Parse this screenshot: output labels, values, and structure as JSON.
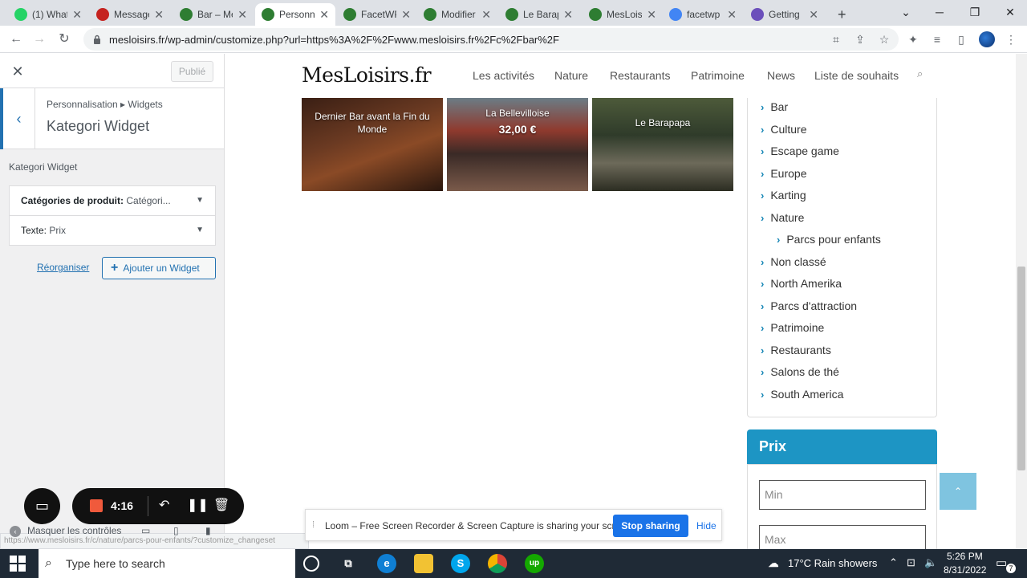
{
  "browser": {
    "tabs": [
      {
        "label": "(1) What",
        "icon": "whatsapp-icon",
        "color": "#25d366"
      },
      {
        "label": "Message",
        "icon": "gmail-icon",
        "color": "#c5221f"
      },
      {
        "label": "Bar – Me",
        "icon": "site-icon",
        "color": "#2e7d32"
      },
      {
        "label": "Personn",
        "icon": "site-icon",
        "color": "#2e7d32"
      },
      {
        "label": "FacetWP",
        "icon": "site-icon",
        "color": "#2e7d32"
      },
      {
        "label": "Modifier",
        "icon": "site-icon",
        "color": "#2e7d32"
      },
      {
        "label": "Le Barap",
        "icon": "site-icon",
        "color": "#2e7d32"
      },
      {
        "label": "MesLois",
        "icon": "site-icon",
        "color": "#2e7d32"
      },
      {
        "label": "facetwp",
        "icon": "google-icon",
        "color": "#4285f4"
      },
      {
        "label": "Getting",
        "icon": "diamond-icon",
        "color": "#6b4fbb"
      }
    ],
    "url": "mesloisirs.fr/wp-admin/customize.php?url=https%3A%2F%2Fwww.mesloisirs.fr%2Fc%2Fbar%2F"
  },
  "customizer": {
    "publish_label": "Publié",
    "breadcrumb": "Personnalisation ▸ Widgets",
    "panel_title": "Kategori Widget",
    "section_label": "Kategori Widget",
    "widgets": [
      {
        "name": "Catégories de produit:",
        "value": "Catégori..."
      },
      {
        "name": "Texte:",
        "value": "Prix"
      }
    ],
    "reorder_label": "Réorganiser",
    "add_widget_label": "Ajouter un Widget",
    "hide_controls_label": "Masquer les contrôles"
  },
  "site": {
    "logo": "MesLoisirs.fr",
    "nav": [
      "Les activités",
      "Nature",
      "Restaurants",
      "Patrimoine",
      "News",
      "Liste de souhaits"
    ],
    "cards": [
      {
        "title": "Dernier Bar avant la Fin du Monde",
        "price": ""
      },
      {
        "title": "La Bellevilloise",
        "price": "32,00 €"
      },
      {
        "title": "Le Barapapa",
        "price": ""
      }
    ],
    "categories": [
      {
        "label": "Bar",
        "sub": false
      },
      {
        "label": "Culture",
        "sub": false
      },
      {
        "label": "Escape game",
        "sub": false
      },
      {
        "label": "Europe",
        "sub": false
      },
      {
        "label": "Karting",
        "sub": false
      },
      {
        "label": "Nature",
        "sub": false
      },
      {
        "label": "Parcs pour enfants",
        "sub": true
      },
      {
        "label": "Non classé",
        "sub": false
      },
      {
        "label": "North Amerika",
        "sub": false
      },
      {
        "label": "Parcs d'attraction",
        "sub": false
      },
      {
        "label": "Patrimoine",
        "sub": false
      },
      {
        "label": "Restaurants",
        "sub": false
      },
      {
        "label": "Salons de thé",
        "sub": false
      },
      {
        "label": "South America",
        "sub": false
      }
    ],
    "prix_title": "Prix",
    "min_placeholder": "Min",
    "max_placeholder": "Max"
  },
  "loom": {
    "message": "Loom – Free Screen Recorder & Screen Capture is sharing your screen.",
    "stop_label": "Stop sharing",
    "hide_label": "Hide",
    "timer": "4:16"
  },
  "status_url": "https://www.mesloisirs.fr/c/nature/parcs-pour-enfants/?customize_changeset",
  "taskbar": {
    "search_placeholder": "Type here to search",
    "weather": "17°C  Rain showers",
    "time": "5:26 PM",
    "date": "8/31/2022",
    "notification_count": "7"
  }
}
